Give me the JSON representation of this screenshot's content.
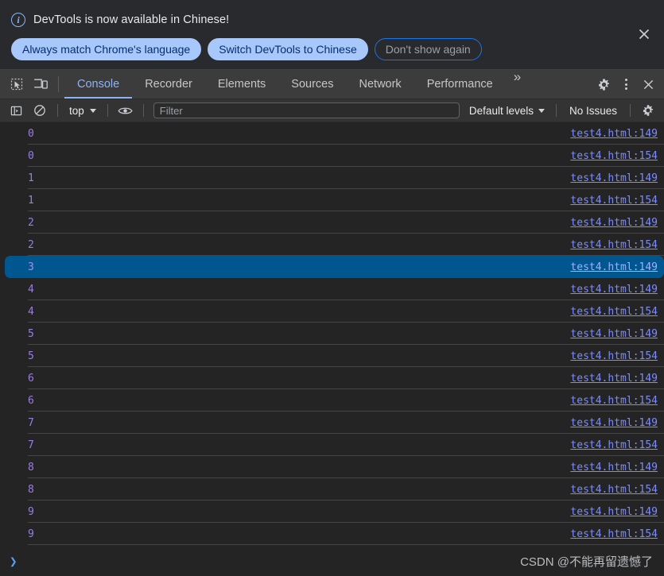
{
  "banner": {
    "icon": "info-circle-icon",
    "message": "DevTools is now available in Chinese!",
    "buttons": [
      {
        "label": "Always match Chrome's language",
        "style": "primary"
      },
      {
        "label": "Switch DevTools to Chinese",
        "style": "primary"
      },
      {
        "label": "Don't show again",
        "style": "outline"
      }
    ],
    "close_icon": "close-icon"
  },
  "tabbar": {
    "inspect_icon": "inspect-element-icon",
    "device_icon": "device-toolbar-icon",
    "tabs": [
      {
        "label": "Console",
        "active": true
      },
      {
        "label": "Recorder",
        "active": false
      },
      {
        "label": "Elements",
        "active": false
      },
      {
        "label": "Sources",
        "active": false
      },
      {
        "label": "Network",
        "active": false
      },
      {
        "label": "Performance",
        "active": false
      }
    ],
    "overflow_label": "»",
    "settings_icon": "gear-icon",
    "more_icon": "kebab-menu-icon",
    "close_icon": "close-icon"
  },
  "filterbar": {
    "sidebar_icon": "console-sidebar-icon",
    "clear_icon": "clear-console-icon",
    "context": "top",
    "eye_icon": "live-expression-eye-icon",
    "filter_placeholder": "Filter",
    "filter_value": "",
    "levels_label": "Default levels",
    "issues_label": "No Issues",
    "settings_icon": "gear-icon"
  },
  "console": {
    "rows": [
      {
        "value": "0",
        "link": "test4.html:149",
        "selected": false
      },
      {
        "value": "0",
        "link": "test4.html:154",
        "selected": false
      },
      {
        "value": "1",
        "link": "test4.html:149",
        "selected": false
      },
      {
        "value": "1",
        "link": "test4.html:154",
        "selected": false
      },
      {
        "value": "2",
        "link": "test4.html:149",
        "selected": false
      },
      {
        "value": "2",
        "link": "test4.html:154",
        "selected": false
      },
      {
        "value": "3",
        "link": "test4.html:149",
        "selected": true
      },
      {
        "value": "4",
        "link": "test4.html:149",
        "selected": false
      },
      {
        "value": "4",
        "link": "test4.html:154",
        "selected": false
      },
      {
        "value": "5",
        "link": "test4.html:149",
        "selected": false
      },
      {
        "value": "5",
        "link": "test4.html:154",
        "selected": false
      },
      {
        "value": "6",
        "link": "test4.html:149",
        "selected": false
      },
      {
        "value": "6",
        "link": "test4.html:154",
        "selected": false
      },
      {
        "value": "7",
        "link": "test4.html:149",
        "selected": false
      },
      {
        "value": "7",
        "link": "test4.html:154",
        "selected": false
      },
      {
        "value": "8",
        "link": "test4.html:149",
        "selected": false
      },
      {
        "value": "8",
        "link": "test4.html:154",
        "selected": false
      },
      {
        "value": "9",
        "link": "test4.html:149",
        "selected": false
      },
      {
        "value": "9",
        "link": "test4.html:154",
        "selected": false
      }
    ]
  },
  "prompt": {
    "chevron": "❯",
    "input_value": "",
    "watermark": "CSDN @不能再留遗憾了"
  },
  "colors": {
    "accent_blue": "#8ab4f8",
    "selection_blue": "#00568f",
    "value_purple": "#9a7fe0",
    "link_blue": "#7b8cff",
    "banner_bg": "#292a2d",
    "tabbar_bg": "#3c3c3c",
    "console_bg": "#242424"
  }
}
